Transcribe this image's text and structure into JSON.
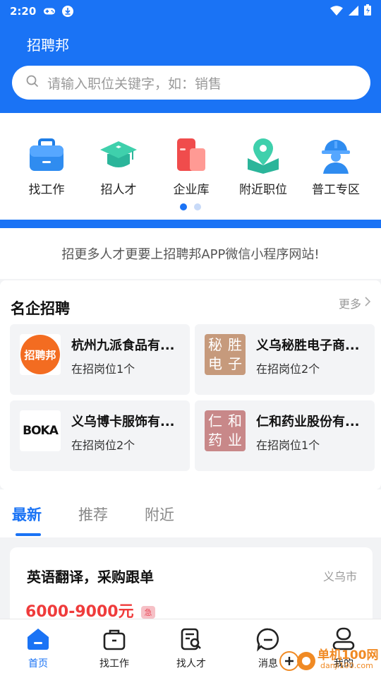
{
  "status": {
    "time": "2:20"
  },
  "app": {
    "title": "招聘邦"
  },
  "search": {
    "placeholder": "请输入职位关键字，如：销售"
  },
  "categories": [
    {
      "label": "找工作",
      "icon": "briefcase-icon"
    },
    {
      "label": "招人才",
      "icon": "graduation-cap-icon"
    },
    {
      "label": "企业库",
      "icon": "building-icon"
    },
    {
      "label": "附近职位",
      "icon": "location-pin-icon"
    },
    {
      "label": "普工专区",
      "icon": "worker-helmet-icon"
    }
  ],
  "banner": {
    "text": "招更多人才更要上招聘邦APP微信小程序网站!"
  },
  "famous": {
    "title": "名企招聘",
    "more": "更多",
    "companies": [
      {
        "name": "杭州九派食品有...",
        "positions": "在招岗位1个",
        "logo_text": "招聘邦"
      },
      {
        "name": "义乌秘胜电子商...",
        "positions": "在招岗位2个",
        "logo_chars": [
          "秘",
          "胜",
          "电",
          "子"
        ]
      },
      {
        "name": "义乌博卡服饰有...",
        "positions": "在招岗位2个",
        "logo_text": "BOKA"
      },
      {
        "name": "仁和药业股份有...",
        "positions": "在招岗位1个",
        "logo_chars": [
          "仁",
          "和",
          "药",
          "业"
        ]
      }
    ]
  },
  "tabs": [
    {
      "label": "最新",
      "active": true
    },
    {
      "label": "推荐",
      "active": false
    },
    {
      "label": "附近",
      "active": false
    }
  ],
  "jobs": [
    {
      "title": "英语翻译，采购跟单",
      "location": "义乌市",
      "salary": "6000-9000元",
      "badge": "急"
    }
  ],
  "tabbar": [
    {
      "label": "首页",
      "icon": "home-icon",
      "active": true
    },
    {
      "label": "找工作",
      "icon": "briefcase-outline-icon",
      "active": false
    },
    {
      "label": "找人才",
      "icon": "search-resume-icon",
      "active": false
    },
    {
      "label": "消息",
      "icon": "chat-icon",
      "active": false
    },
    {
      "label": "我的",
      "icon": "user-icon",
      "active": false
    }
  ],
  "watermark": {
    "brand": "单机100网",
    "url": "danji100.com"
  },
  "colors": {
    "primary": "#1a73f5",
    "salary": "#ef3b3b"
  }
}
